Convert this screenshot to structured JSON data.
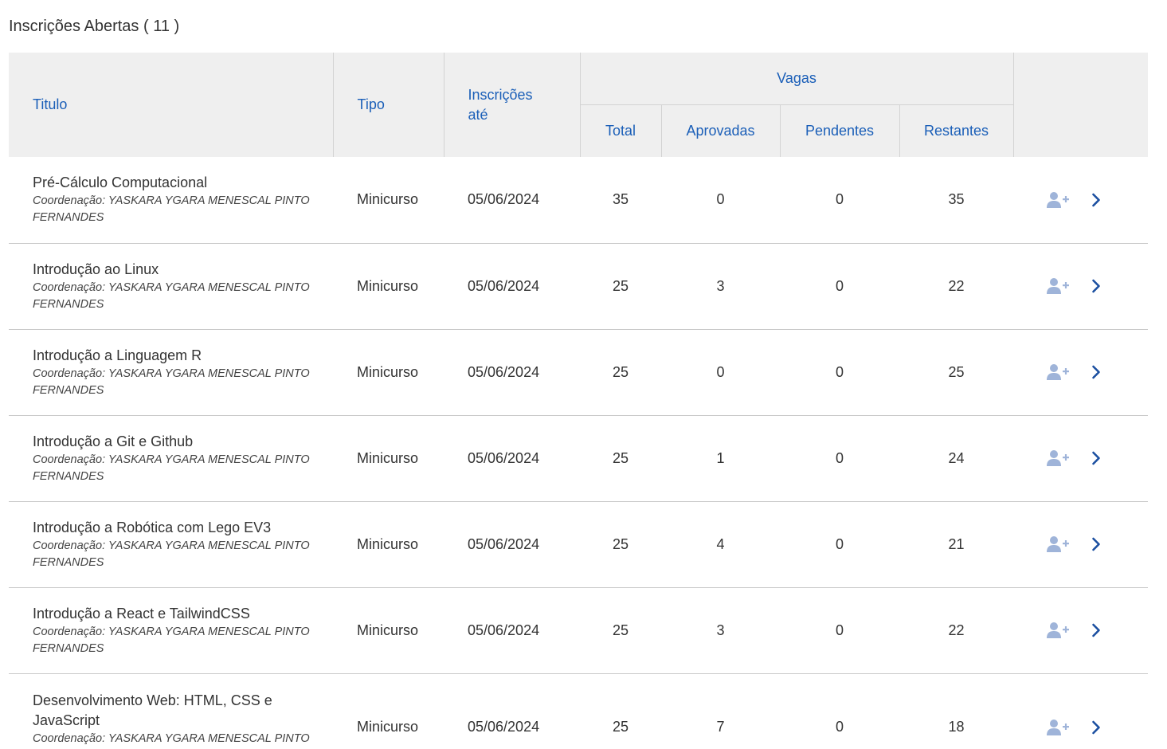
{
  "section": {
    "title": "Inscrições Abertas",
    "count": "( 11 )"
  },
  "headers": {
    "titulo": "Titulo",
    "tipo": "Tipo",
    "inscricoes_line1": "Inscrições",
    "inscricoes_line2": "até",
    "vagas": "Vagas",
    "total": "Total",
    "aprovadas": "Aprovadas",
    "pendentes": "Pendentes",
    "restantes": "Restantes"
  },
  "rows": [
    {
      "title": "Pré-Cálculo Computacional",
      "coord_label": "Coordenação:",
      "coord": "YASKARA YGARA MENESCAL PINTO FERNANDES",
      "tipo": "Minicurso",
      "date": "05/06/2024",
      "total": "35",
      "aprovadas": "0",
      "pendentes": "0",
      "restantes": "35"
    },
    {
      "title": "Introdução ao Linux",
      "coord_label": "Coordenação:",
      "coord": "YASKARA YGARA MENESCAL PINTO FERNANDES",
      "tipo": "Minicurso",
      "date": "05/06/2024",
      "total": "25",
      "aprovadas": "3",
      "pendentes": "0",
      "restantes": "22"
    },
    {
      "title": "Introdução a Linguagem R",
      "coord_label": "Coordenação:",
      "coord": "YASKARA YGARA MENESCAL PINTO FERNANDES",
      "tipo": "Minicurso",
      "date": "05/06/2024",
      "total": "25",
      "aprovadas": "0",
      "pendentes": "0",
      "restantes": "25"
    },
    {
      "title": "Introdução a Git e Github",
      "coord_label": "Coordenação:",
      "coord": "YASKARA YGARA MENESCAL PINTO FERNANDES",
      "tipo": "Minicurso",
      "date": "05/06/2024",
      "total": "25",
      "aprovadas": "1",
      "pendentes": "0",
      "restantes": "24"
    },
    {
      "title": "Introdução a Robótica com Lego EV3",
      "coord_label": "Coordenação:",
      "coord": "YASKARA YGARA MENESCAL PINTO FERNANDES",
      "tipo": "Minicurso",
      "date": "05/06/2024",
      "total": "25",
      "aprovadas": "4",
      "pendentes": "0",
      "restantes": "21"
    },
    {
      "title": "Introdução a React e TailwindCSS",
      "coord_label": "Coordenação:",
      "coord": "YASKARA YGARA MENESCAL PINTO FERNANDES",
      "tipo": "Minicurso",
      "date": "05/06/2024",
      "total": "25",
      "aprovadas": "3",
      "pendentes": "0",
      "restantes": "22"
    },
    {
      "title": "Desenvolvimento Web: HTML, CSS e JavaScript",
      "coord_label": "Coordenação:",
      "coord": "YASKARA YGARA MENESCAL PINTO FERNANDES",
      "tipo": "Minicurso",
      "date": "05/06/2024",
      "total": "25",
      "aprovadas": "7",
      "pendentes": "0",
      "restantes": "18"
    }
  ],
  "icons": {
    "enroll": "user-plus-icon",
    "details": "chevron-right-icon"
  },
  "colors": {
    "header_text": "#1b5fb8",
    "header_bg": "#efefef",
    "enroll_icon": "#9fb4d9",
    "chevron": "#1b4fa0"
  }
}
